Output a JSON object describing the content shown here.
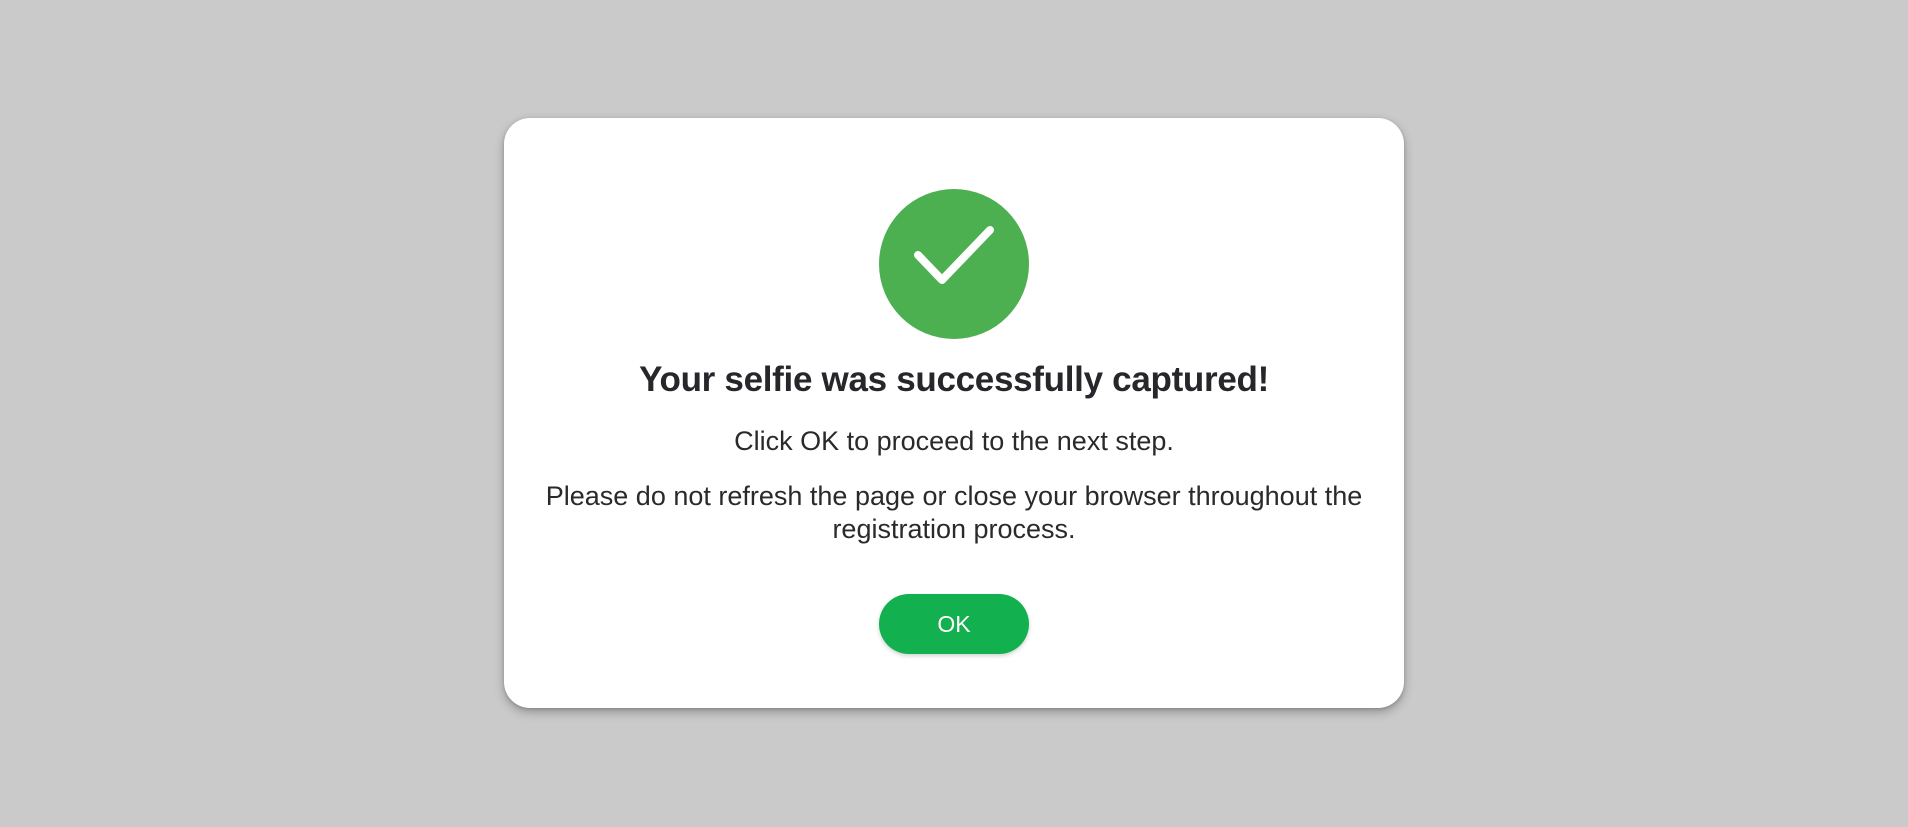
{
  "dialog": {
    "icon": "check-icon",
    "icon_color": "#4caf50",
    "title": "Your selfie was successfully captured!",
    "instruction": "Click OK to proceed to the next step.",
    "warning": "Please do not refresh the page or close your browser throughout the registration process.",
    "ok_label": "OK",
    "ok_color": "#13b04f"
  },
  "page": {
    "background": "#cacaca"
  }
}
